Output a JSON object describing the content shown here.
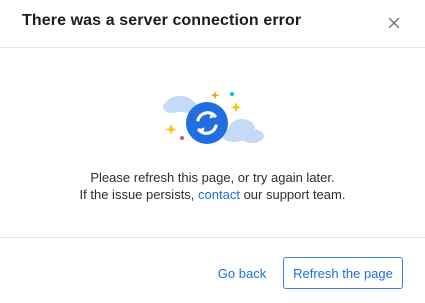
{
  "dialog": {
    "title": "There was a server connection error",
    "close_icon": "close-icon"
  },
  "illustration": {
    "icon": "refresh-sync-icon",
    "colors": {
      "circle": "#1f6fe0",
      "cloud": "#c4daf7",
      "sparkle_yellow": "#f7c619",
      "sparkle_orange": "#f59a23",
      "dot_teal": "#14c3d5",
      "dot_pink": "#e7457e"
    }
  },
  "message": {
    "line1": "Please refresh this page, or try again later.",
    "line2_before": "If the issue persists, ",
    "line2_link": "contact",
    "line2_after": " our support team."
  },
  "actions": {
    "secondary_label": "Go back",
    "primary_label": "Refresh the page"
  },
  "colors": {
    "accent": "#1e6fe0",
    "title": "#1b1d21",
    "divider": "#e4e6ea"
  }
}
